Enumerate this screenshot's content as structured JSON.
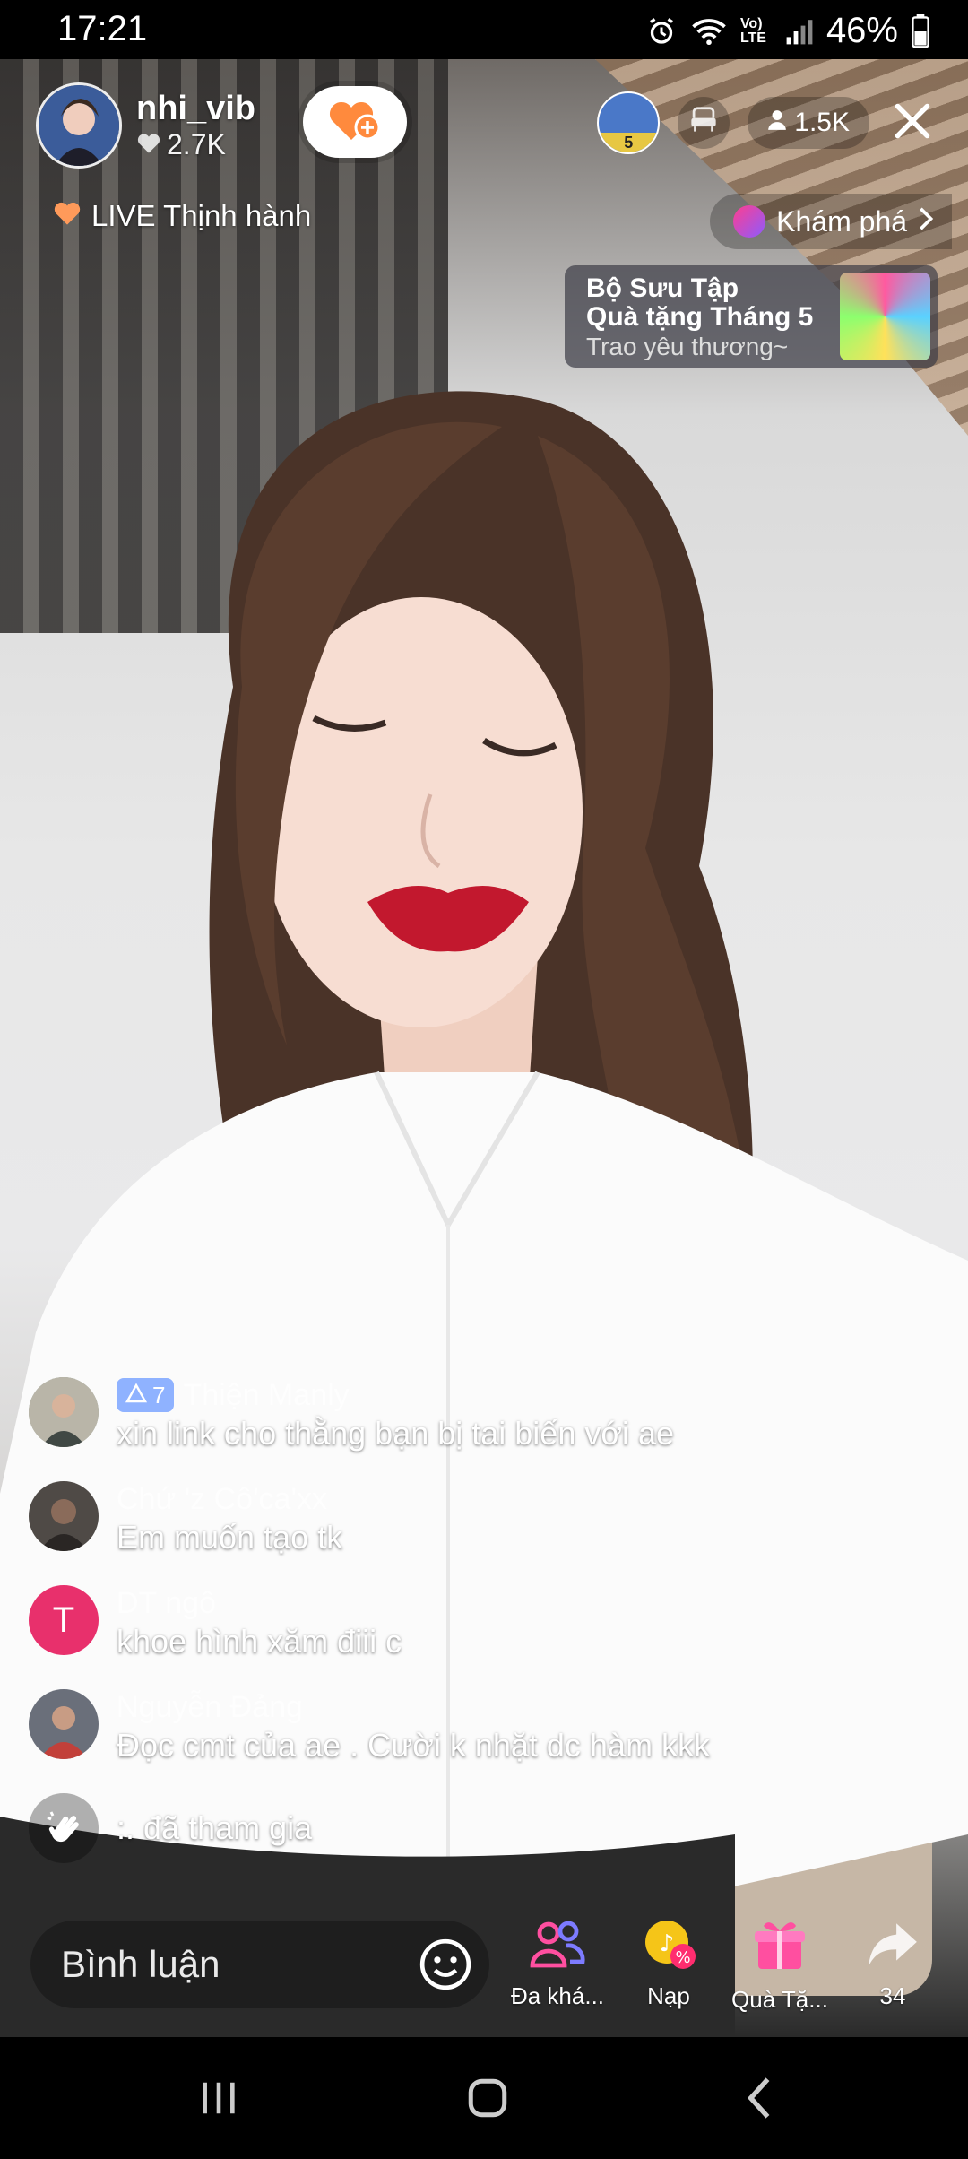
{
  "status_bar": {
    "time": "17:21",
    "network": "Vo) LTE",
    "battery": "46%"
  },
  "host": {
    "name": "nhi_vib",
    "likes": "2.7K"
  },
  "top_right": {
    "rank_number": "5",
    "viewers": "1.5K"
  },
  "live_tag": "LIVE Thịnh hành",
  "explore_label": "Khám phá",
  "promo": {
    "line1": "Bộ Sưu Tập",
    "line2": "Quà tặng Tháng 5",
    "line3": "Trao yêu thương~"
  },
  "comments": [
    {
      "user": "Thiện Manly",
      "badge_level": "7",
      "text": "xin link cho thằng bạn bị tai biến với ae"
    },
    {
      "user": "Chứ 'z Cô'ca'xx",
      "text": "Em muốn tạo tk"
    },
    {
      "user": "DT ngô",
      "avatar_letter": "T",
      "text": "khoe hình xăm điii c"
    },
    {
      "user": "Nguyễn Đảng",
      "text": "Đọc cmt của ae . Cười k nhặt dc hàm kkk"
    }
  ],
  "join_message": ":. đã tham gia",
  "bottom": {
    "comment_placeholder": "Bình luận",
    "multi_guest_label": "Đa khá...",
    "recharge_label": "Nạp",
    "gift_label": "Quà Tặ...",
    "share_count": "34"
  },
  "colors": {
    "accent_pink": "#ff2d6f",
    "follow_heart": "#ff8a3d",
    "badge_blue": "#8fb2ff"
  },
  "icons": [
    "alarm-icon",
    "wifi-icon",
    "signal-icon",
    "battery-icon",
    "heart-icon",
    "add-follow-icon",
    "viewer-icon",
    "close-icon",
    "seat-icon",
    "emoji-icon",
    "multi-guest-icon",
    "recharge-icon",
    "gift-icon",
    "share-icon",
    "wave-icon"
  ]
}
